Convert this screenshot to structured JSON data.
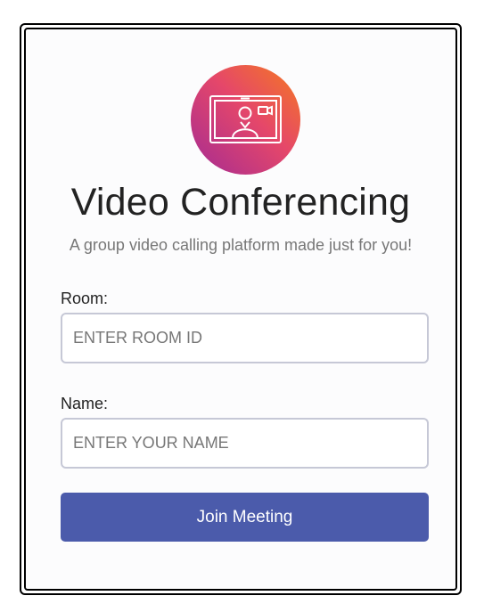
{
  "app": {
    "title": "Video Conferencing",
    "subtitle": "A group video calling platform made just for you!",
    "logo_icon": "video-call-icon",
    "accent_color": "#4b5bab"
  },
  "form": {
    "room": {
      "label": "Room:",
      "placeholder": "ENTER ROOM ID",
      "value": ""
    },
    "name": {
      "label": "Name:",
      "placeholder": "ENTER YOUR NAME",
      "value": ""
    },
    "join_label": "Join Meeting"
  }
}
